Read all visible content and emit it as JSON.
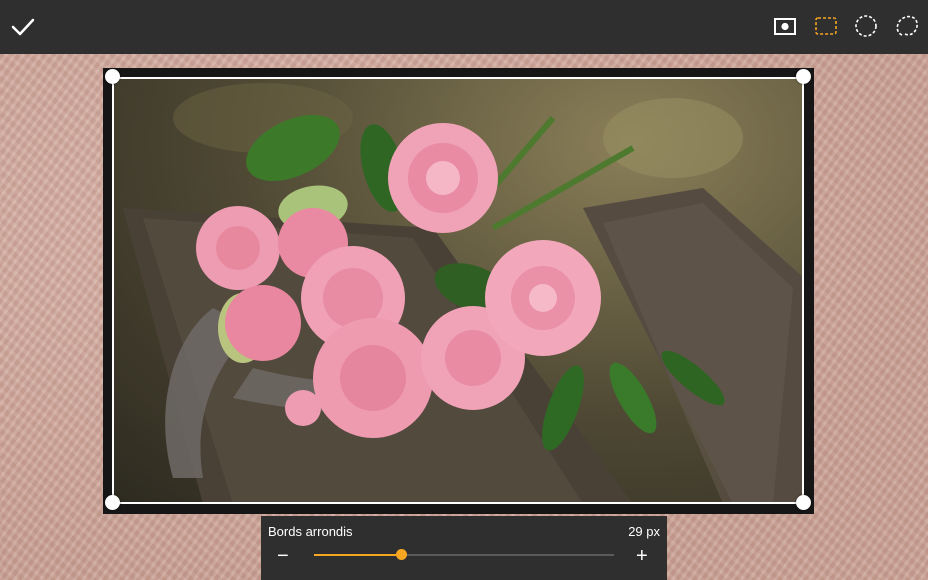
{
  "toolbar": {
    "confirm_icon": "check-icon",
    "shapes": [
      {
        "name": "rectangle-shape-icon",
        "selected": false
      },
      {
        "name": "rounded-rectangle-shape-icon",
        "selected": true
      },
      {
        "name": "ellipse-shape-icon",
        "selected": false
      },
      {
        "name": "freehand-shape-icon",
        "selected": false
      }
    ],
    "accent_color": "#f5a623"
  },
  "canvas": {
    "image_subject": "pink carnations on wooden bench"
  },
  "panel": {
    "label": "Bords arrondis",
    "value": "29 px",
    "minus": "−",
    "plus": "+",
    "slider_fraction": 0.29
  }
}
